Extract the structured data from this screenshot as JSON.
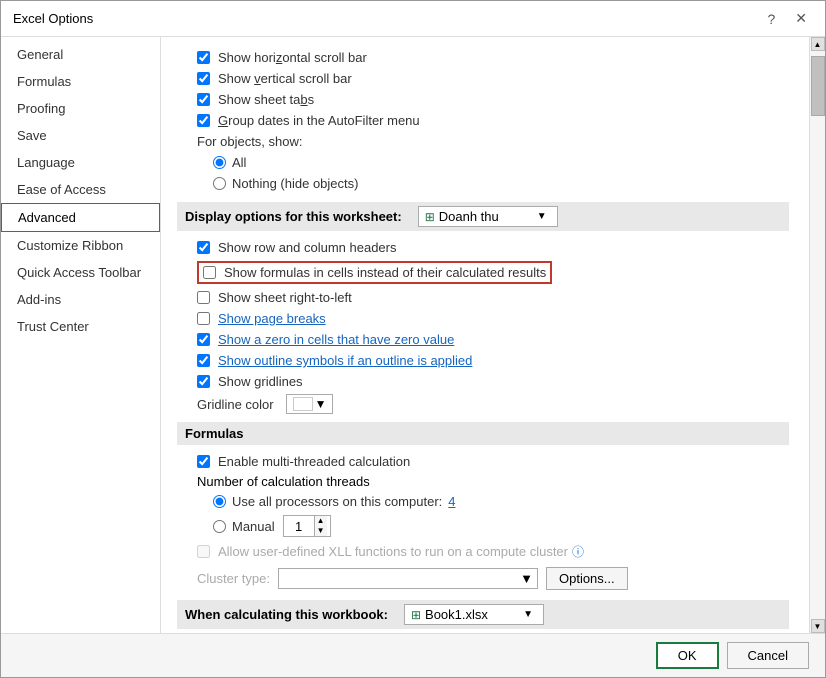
{
  "dialog": {
    "title": "Excel Options",
    "help_btn": "?",
    "close_btn": "✕"
  },
  "sidebar": {
    "items": [
      {
        "id": "general",
        "label": "General",
        "active": false
      },
      {
        "id": "formulas",
        "label": "Formulas",
        "active": false
      },
      {
        "id": "proofing",
        "label": "Proofing",
        "active": false
      },
      {
        "id": "save",
        "label": "Save",
        "active": false
      },
      {
        "id": "language",
        "label": "Language",
        "active": false
      },
      {
        "id": "ease-of-access",
        "label": "Ease of Access",
        "active": false
      },
      {
        "id": "advanced",
        "label": "Advanced",
        "active": true
      },
      {
        "id": "customize-ribbon",
        "label": "Customize Ribbon",
        "active": false
      },
      {
        "id": "quick-access-toolbar",
        "label": "Quick Access Toolbar",
        "active": false
      },
      {
        "id": "add-ins",
        "label": "Add-ins",
        "active": false
      },
      {
        "id": "trust-center",
        "label": "Trust Center",
        "active": false
      }
    ]
  },
  "main": {
    "display_section_label": "Display options for this worksheet:",
    "worksheet_name": "Doanh thu",
    "options_display": [
      {
        "id": "show-horizontal-scroll",
        "checked": true,
        "label": "Show horizontal scroll bar"
      },
      {
        "id": "show-vertical-scroll",
        "checked": true,
        "label": "Show vertical scroll bar"
      },
      {
        "id": "show-sheet-tabs",
        "checked": true,
        "label": "Show sheet tabs"
      },
      {
        "id": "group-dates",
        "checked": true,
        "label": "Group dates in the AutoFilter menu"
      }
    ],
    "objects_show_label": "For objects, show:",
    "objects_radio": [
      {
        "id": "all",
        "checked": true,
        "label": "All"
      },
      {
        "id": "nothing",
        "checked": false,
        "label": "Nothing (hide objects)"
      }
    ],
    "worksheet_options": [
      {
        "id": "show-row-col-headers",
        "checked": true,
        "label": "Show row and column headers"
      },
      {
        "id": "show-formulas",
        "checked": false,
        "label": "Show formulas in cells instead of their calculated results",
        "highlighted": true
      },
      {
        "id": "show-sheet-rtl",
        "checked": false,
        "label": "Show sheet right-to-left"
      },
      {
        "id": "show-page-breaks",
        "checked": false,
        "label": "Show page breaks"
      },
      {
        "id": "show-zero",
        "checked": true,
        "label": "Show a zero in cells that have zero value"
      },
      {
        "id": "show-outline",
        "checked": true,
        "label": "Show outline symbols if an outline is applied"
      },
      {
        "id": "show-gridlines",
        "checked": true,
        "label": "Show gridlines"
      }
    ],
    "gridline_color_label": "Gridline color",
    "formulas_section": {
      "header": "Formulas",
      "enable_multithreaded": {
        "checked": true,
        "label": "Enable multi-threaded calculation"
      },
      "num_threads_label": "Number of calculation threads",
      "use_all_processors": {
        "checked": true,
        "label": "Use all processors on this computer:"
      },
      "processor_count": "4",
      "manual": {
        "checked": false,
        "label": "Manual"
      },
      "manual_value": "1",
      "allow_xll_label": "Allow user-defined XLL functions to run on a compute cluster",
      "cluster_type_label": "Cluster type:",
      "options_btn_label": "Options..."
    },
    "when_calculating_label": "When calculating this workbook:",
    "workbook_name": "Book1.xlsx"
  },
  "footer": {
    "ok_label": "OK",
    "cancel_label": "Cancel"
  }
}
